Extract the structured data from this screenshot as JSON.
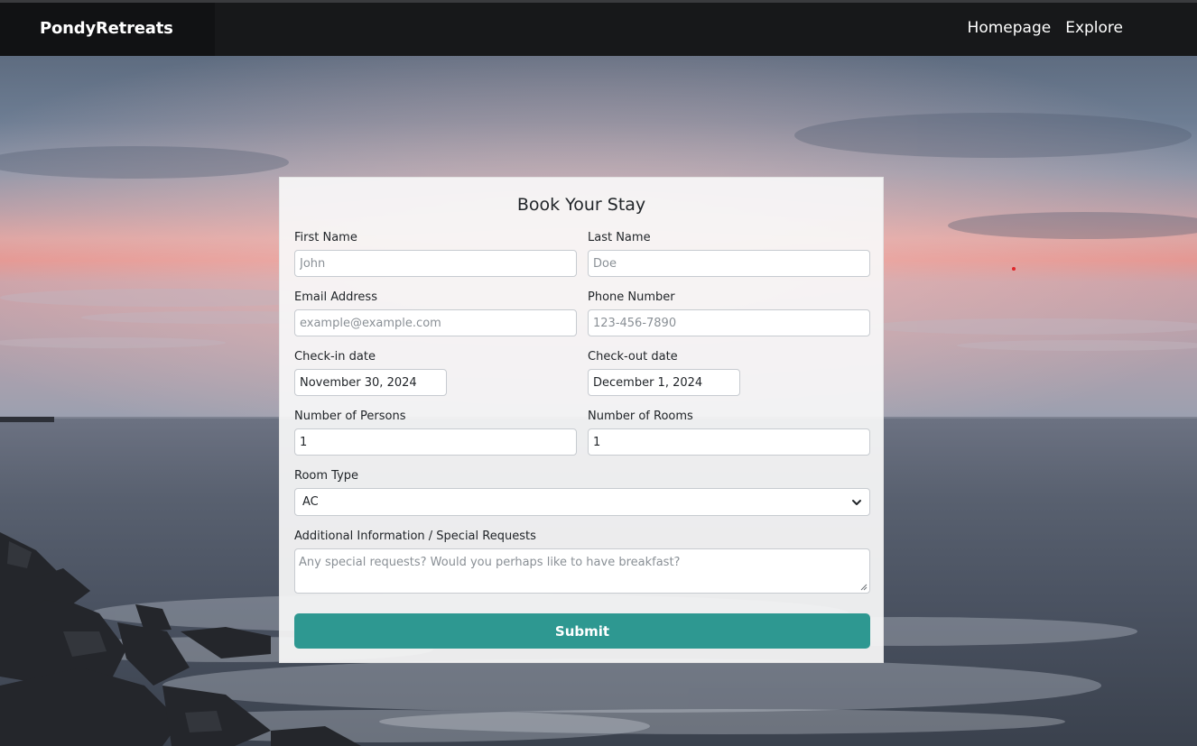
{
  "navbar": {
    "brand": "PondyRetreats",
    "links": [
      "Homepage",
      "Explore"
    ]
  },
  "form": {
    "title": "Book Your Stay",
    "first_name": {
      "label": "First Name",
      "placeholder": "John",
      "value": ""
    },
    "last_name": {
      "label": "Last Name",
      "placeholder": "Doe",
      "value": ""
    },
    "email": {
      "label": "Email Address",
      "placeholder": "example@example.com",
      "value": ""
    },
    "phone": {
      "label": "Phone Number",
      "placeholder": "123-456-7890",
      "value": ""
    },
    "check_in": {
      "label": "Check-in date",
      "value": "November 30, 2024"
    },
    "check_out": {
      "label": "Check-out date",
      "value": "December 1, 2024"
    },
    "persons": {
      "label": "Number of Persons",
      "value": "1"
    },
    "rooms": {
      "label": "Number of Rooms",
      "value": "1"
    },
    "room_type": {
      "label": "Room Type",
      "value": "AC"
    },
    "additional": {
      "label": "Additional Information / Special Requests",
      "placeholder": "Any special requests? Would you perhaps like to have breakfast?",
      "value": ""
    },
    "submit_label": "Submit"
  },
  "colors": {
    "navbar": "#17181a",
    "accent": "#2e9891",
    "card": "#f8f8f8"
  },
  "icons": {
    "room_type_select": "chevron-down-icon",
    "textarea_corner": "resize-grip-icon"
  }
}
